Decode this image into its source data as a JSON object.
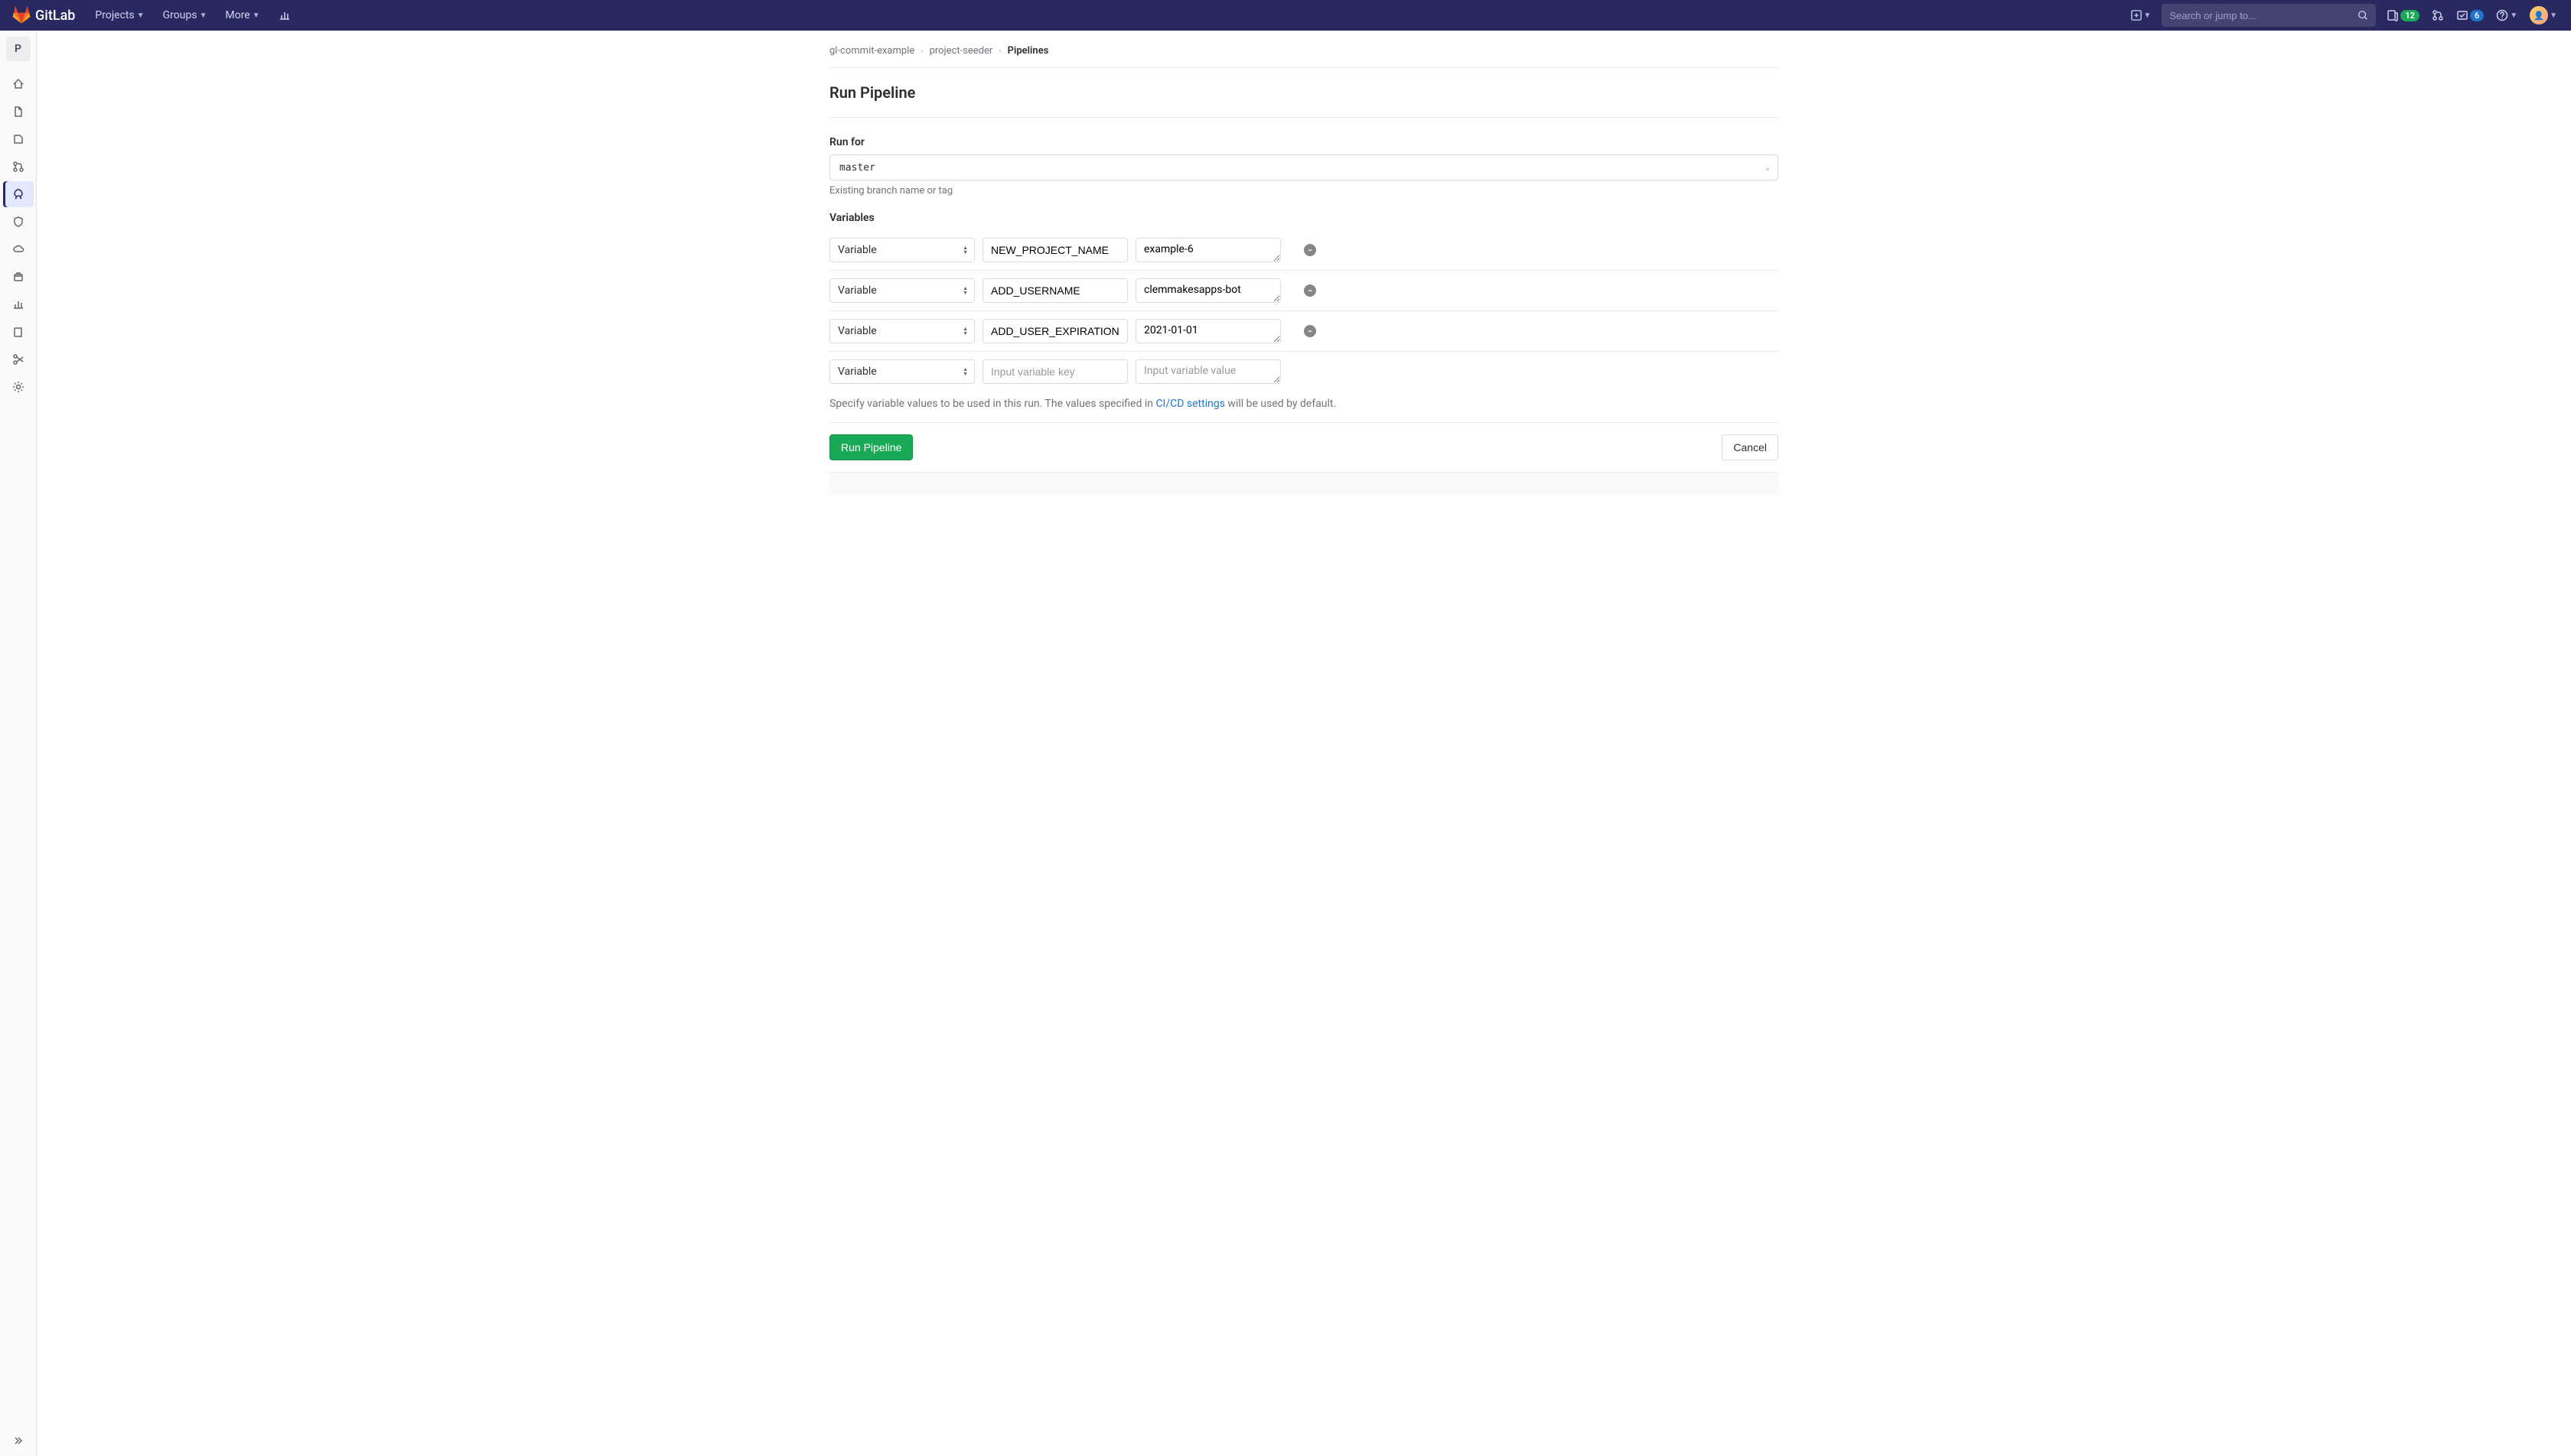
{
  "brand": "GitLab",
  "nav": {
    "projects": "Projects",
    "groups": "Groups",
    "more": "More"
  },
  "search": {
    "placeholder": "Search or jump to..."
  },
  "badges": {
    "issues": "12",
    "todos": "6"
  },
  "sidebar": {
    "project_letter": "P"
  },
  "breadcrumbs": {
    "group": "gl-commit-example",
    "project": "project-seeder",
    "current": "Pipelines"
  },
  "page": {
    "title": "Run Pipeline",
    "run_for_label": "Run for",
    "branch": "master",
    "branch_hint": "Existing branch name or tag",
    "variables_label": "Variables",
    "var_type": "Variable",
    "key_placeholder": "Input variable key",
    "value_placeholder": "Input variable value",
    "help_prefix": "Specify variable values to be used in this run. The values specified in ",
    "help_link": "CI/CD settings",
    "help_suffix": " will be used by default.",
    "run_button": "Run Pipeline",
    "cancel_button": "Cancel"
  },
  "variables": [
    {
      "key": "NEW_PROJECT_NAME",
      "value": "example-6"
    },
    {
      "key": "ADD_USERNAME",
      "value": "clemmakesapps-bot"
    },
    {
      "key": "ADD_USER_EXPIRATION",
      "value": "2021-01-01"
    }
  ]
}
